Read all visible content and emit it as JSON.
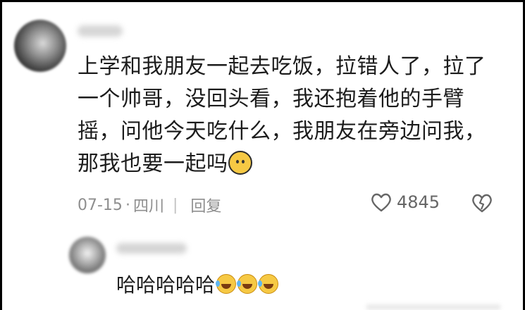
{
  "comment": {
    "lines": [
      "上学和我朋友一起去吃饭，拉错人了，拉了",
      "一个帅哥，没回头看，我还抱着他的手臂",
      "摇，问他今天吃什么，我朋友在旁边问我，",
      "那我也要一起吗"
    ],
    "emoji": "crying-face-emoji",
    "date": "07-15",
    "location": "四川",
    "reply_label": "回复",
    "like_count": "4845"
  },
  "reply": {
    "text": "哈哈哈哈哈",
    "emoji": "laughing-tears-emoji",
    "emoji_count": 3
  },
  "colors": {
    "text": "#1c1c1c",
    "meta": "#8e8e8e",
    "emoji": "#f6c944"
  }
}
